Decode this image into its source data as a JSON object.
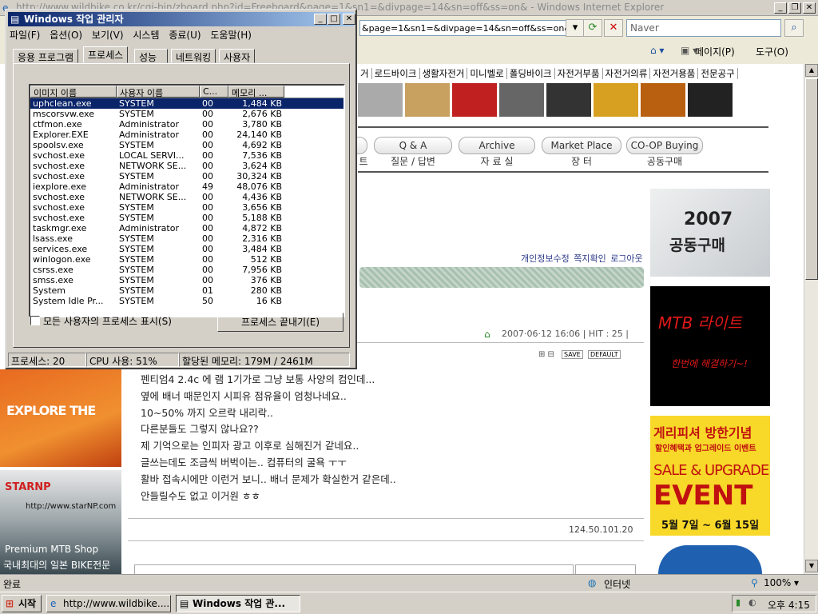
{
  "ie": {
    "title": "http://www.wildbike.co.kr/cgi-bin/zboard.php?id=Freeboard&page=1&sn1=&divpage=14&sn=off&ss=on& - Windows Internet Explorer",
    "address": "&page=1&sn1=&divpage=14&sn=off&ss=on&sc",
    "search_placeholder": "Naver",
    "page_menu": "페이지(P)",
    "tools_menu": "도구(O)"
  },
  "site": {
    "categories": [
      "거",
      "로드바이크",
      "생활자전거",
      "미니벨로",
      "폴딩바이크",
      "자전거부품",
      "자전거의류",
      "자전거용품",
      "전문공구"
    ],
    "nav": [
      {
        "label": "Q & A",
        "sub": "질문 / 답변"
      },
      {
        "label": "Archive",
        "sub": "자 료 실"
      },
      {
        "label": "Market Place",
        "sub": "장 터"
      },
      {
        "label": "CO-OP Buying",
        "sub": "공동구매"
      }
    ],
    "nav_partial_sub": "트",
    "user_links": "개인정보수정 쪽지확인 로그아웃",
    "post_meta": "2007·06·12 16:06  |  HIT : 25  |",
    "post_lines": [
      "펜티엄4 2.4c 에 램 1기가로 그냥 보통 사양의 컴인데...",
      "옆에 배너 때문인지 시피유 점유율이 엄청나네요..",
      "10~50% 까지 오르락 내리락..",
      "다른분들도 그렇지 않나요??",
      "제 기억으로는 인피자 광고 이후로 심해진거 같네요..",
      "글쓰는데도 조금씩 버벅이는.. 컴퓨터의 굴욕 ㅜㅜ",
      "활바 접속시에만 이런거 보니.. 배너 문제가 확실한거 같은데..",
      "안들릴수도 없고 이거원 ㅎㅎ"
    ],
    "post_ip": "124.50.101.20",
    "save": "SAVE",
    "default": "DEFAULT",
    "banner1_line1": "2007",
    "banner1_line2": "공동구매",
    "banner2_title": "MTB 라이트",
    "banner2_sub": "한번에 해결하기~!",
    "banner3_title": "게리피셔 방한기념",
    "banner3_sub": "할인혜택과 업그레이드 이벤트",
    "banner3_event1": "SALE & UPGRADE",
    "banner3_event2": "EVENT",
    "banner3_date": "5월 7일 ~ 6월 15일",
    "left_banner1": "EXPLORE THE",
    "left_banner2_logo": "STARNP",
    "left_banner2_url": "http://www.starNP.com",
    "left_banner2_shop": "Premium MTB Shop",
    "left_banner2_sub": "국내최대의 일본 BIKE전문"
  },
  "status": {
    "left": "완료",
    "zone": "인터넷",
    "zoom": "100%"
  },
  "taskbar": {
    "start": "시작",
    "task1": "http://www.wildbike....",
    "task2": "Windows 작업 관...",
    "clock": "오후 4:15"
  },
  "taskmgr": {
    "title": "Windows 작업 관리자",
    "menu": [
      "파일(F)",
      "옵션(O)",
      "보기(V)",
      "시스템 종료(U)",
      "도움말(H)"
    ],
    "tabs": [
      "응용 프로그램",
      "프로세스",
      "성능",
      "네트워킹",
      "사용자"
    ],
    "columns": [
      "이미지 이름",
      "사용자 이름",
      "C...",
      "메모리 ..."
    ],
    "processes": [
      [
        "uphclean.exe",
        "SYSTEM",
        "00",
        "1,484 KB"
      ],
      [
        "mscorsvw.exe",
        "SYSTEM",
        "00",
        "2,676 KB"
      ],
      [
        "ctfmon.exe",
        "Administrator",
        "00",
        "3,780 KB"
      ],
      [
        "Explorer.EXE",
        "Administrator",
        "00",
        "24,140 KB"
      ],
      [
        "spoolsv.exe",
        "SYSTEM",
        "00",
        "4,692 KB"
      ],
      [
        "svchost.exe",
        "LOCAL SERVI...",
        "00",
        "7,536 KB"
      ],
      [
        "svchost.exe",
        "NETWORK SE...",
        "00",
        "3,624 KB"
      ],
      [
        "svchost.exe",
        "SYSTEM",
        "00",
        "30,324 KB"
      ],
      [
        "iexplore.exe",
        "Administrator",
        "49",
        "48,076 KB"
      ],
      [
        "svchost.exe",
        "NETWORK SE...",
        "00",
        "4,436 KB"
      ],
      [
        "svchost.exe",
        "SYSTEM",
        "00",
        "3,656 KB"
      ],
      [
        "svchost.exe",
        "SYSTEM",
        "00",
        "5,188 KB"
      ],
      [
        "taskmgr.exe",
        "Administrator",
        "00",
        "4,872 KB"
      ],
      [
        "lsass.exe",
        "SYSTEM",
        "00",
        "2,316 KB"
      ],
      [
        "services.exe",
        "SYSTEM",
        "00",
        "3,484 KB"
      ],
      [
        "winlogon.exe",
        "SYSTEM",
        "00",
        "512 KB"
      ],
      [
        "csrss.exe",
        "SYSTEM",
        "00",
        "7,956 KB"
      ],
      [
        "smss.exe",
        "SYSTEM",
        "00",
        "376 KB"
      ],
      [
        "System",
        "SYSTEM",
        "01",
        "280 KB"
      ],
      [
        "System Idle Pr...",
        "SYSTEM",
        "50",
        "16 KB"
      ]
    ],
    "show_all_label": "모든 사용자의 프로세스 표시(S)",
    "end_process_label": "프로세스 끝내기(E)",
    "status_processes": "프로세스: 20",
    "status_cpu": "CPU 사용: 51%",
    "status_memory": "할당된 메모리: 179M / 2461M"
  }
}
